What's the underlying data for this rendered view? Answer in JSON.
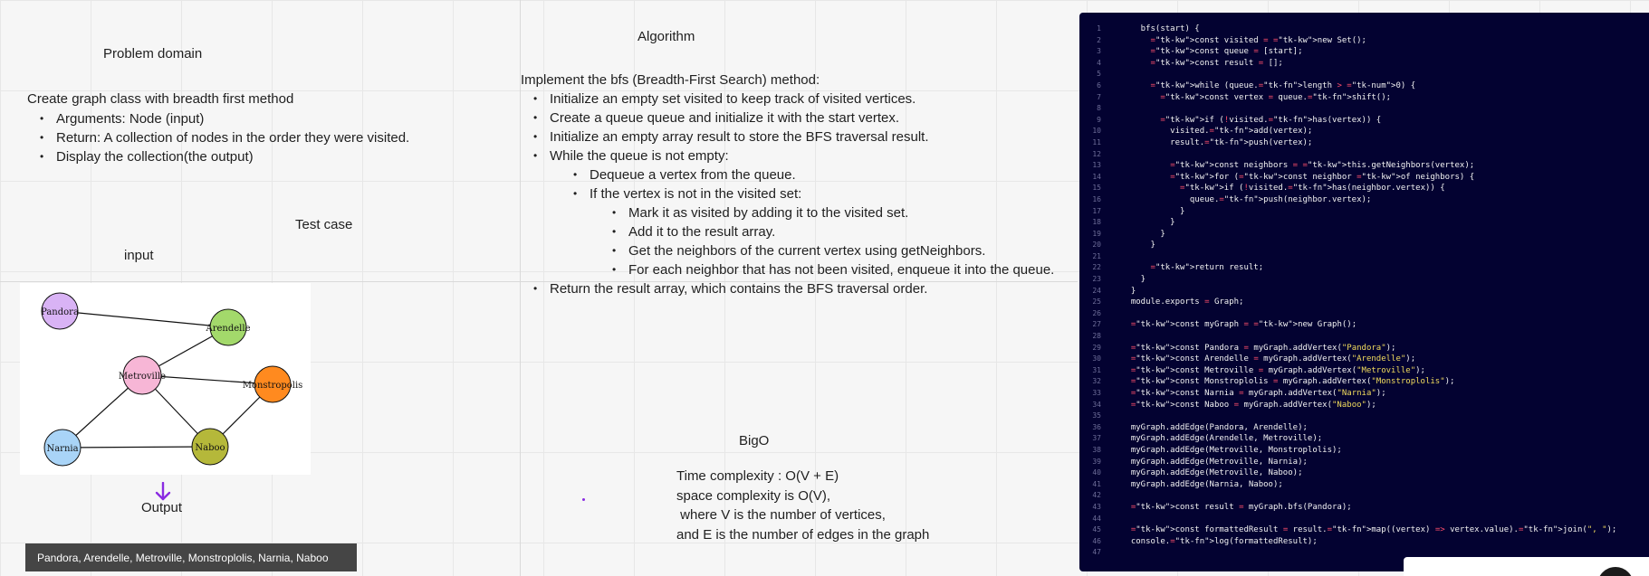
{
  "problem": {
    "heading": "Problem domain",
    "intro": "Create graph class with breadth first method",
    "bullets": [
      "Arguments: Node   (input)",
      "Return: A collection of nodes in the order they were visited.",
      "Display the collection(the output)"
    ]
  },
  "algorithm": {
    "heading": "Algorithm",
    "intro": "Implement the bfs (Breadth-First Search) method:",
    "steps": [
      "Initialize an empty set visited to keep track of visited vertices.",
      "Create a queue queue and initialize it with the start vertex.",
      "Initialize an empty array result to store the BFS traversal result.",
      "While the queue is not empty:",
      "Dequeue a vertex from the queue.",
      "If the vertex is not in the visited set:",
      "Mark it as visited by adding it to the visited set.",
      "Add it to the result array.",
      "Get the neighbors of the current vertex using getNeighbors.",
      "For each neighbor that has not been visited, enqueue it into the queue.",
      "Return the result array, which contains the BFS traversal order."
    ]
  },
  "testcase": {
    "heading": "Test case",
    "input_label": "input",
    "output_label": "Output",
    "output_value": "Pandora, Arendelle, Metroville, Monstroplolis, Narnia, Naboo"
  },
  "graph": {
    "nodes": [
      {
        "label": "Pandora",
        "color": "#d9b3f5"
      },
      {
        "label": "Arendelle",
        "color": "#a3d96b"
      },
      {
        "label": "Metroville",
        "color": "#f7b6d6"
      },
      {
        "label": "Monstropolis",
        "color": "#ff8a1f"
      },
      {
        "label": "Narnia",
        "color": "#a9d4f7"
      },
      {
        "label": "Naboo",
        "color": "#b5b83a"
      }
    ]
  },
  "bigo": {
    "heading": "BigO",
    "lines": [
      "Time complexity : O(V + E)",
      "space complexity is O(V),",
      " where V is the number of vertices,",
      "and E is the number of edges in the graph"
    ]
  },
  "code": {
    "lines": [
      "    bfs(start) {",
      "      const visited = new Set();",
      "      const queue = [start];",
      "      const result = [];",
      "",
      "      while (queue.length > 0) {",
      "        const vertex = queue.shift();",
      "",
      "        if (!visited.has(vertex)) {",
      "          visited.add(vertex);",
      "          result.push(vertex);",
      "",
      "          const neighbors = this.getNeighbors(vertex);",
      "          for (const neighbor of neighbors) {",
      "            if (!visited.has(neighbor.vertex)) {",
      "              queue.push(neighbor.vertex);",
      "            }",
      "          }",
      "        }",
      "      }",
      "",
      "      return result;",
      "    }",
      "  }",
      "  module.exports = Graph;",
      "",
      "  const myGraph = new Graph();",
      "",
      "  const Pandora = myGraph.addVertex(\"Pandora\");",
      "  const Arendelle = myGraph.addVertex(\"Arendelle\");",
      "  const Metroville = myGraph.addVertex(\"Metroville\");",
      "  const Monstroplolis = myGraph.addVertex(\"Monstroplolis\");",
      "  const Narnia = myGraph.addVertex(\"Narnia\");",
      "  const Naboo = myGraph.addVertex(\"Naboo\");",
      "",
      "  myGraph.addEdge(Pandora, Arendelle);",
      "  myGraph.addEdge(Arendelle, Metroville);",
      "  myGraph.addEdge(Metroville, Monstroplolis);",
      "  myGraph.addEdge(Metroville, Narnia);",
      "  myGraph.addEdge(Metroville, Naboo);",
      "  myGraph.addEdge(Narnia, Naboo);",
      "",
      "  const result = myGraph.bfs(Pandora);",
      "",
      "  const formattedResult = result.map((vertex) => vertex.value).join(\", \");",
      "  console.log(formattedResult);",
      ""
    ]
  },
  "colors": {
    "code_bg": "#030231",
    "output_bg": "#454545",
    "arrow": "#8a2be2"
  },
  "icons": {
    "arrow": "arrow-down-icon"
  }
}
